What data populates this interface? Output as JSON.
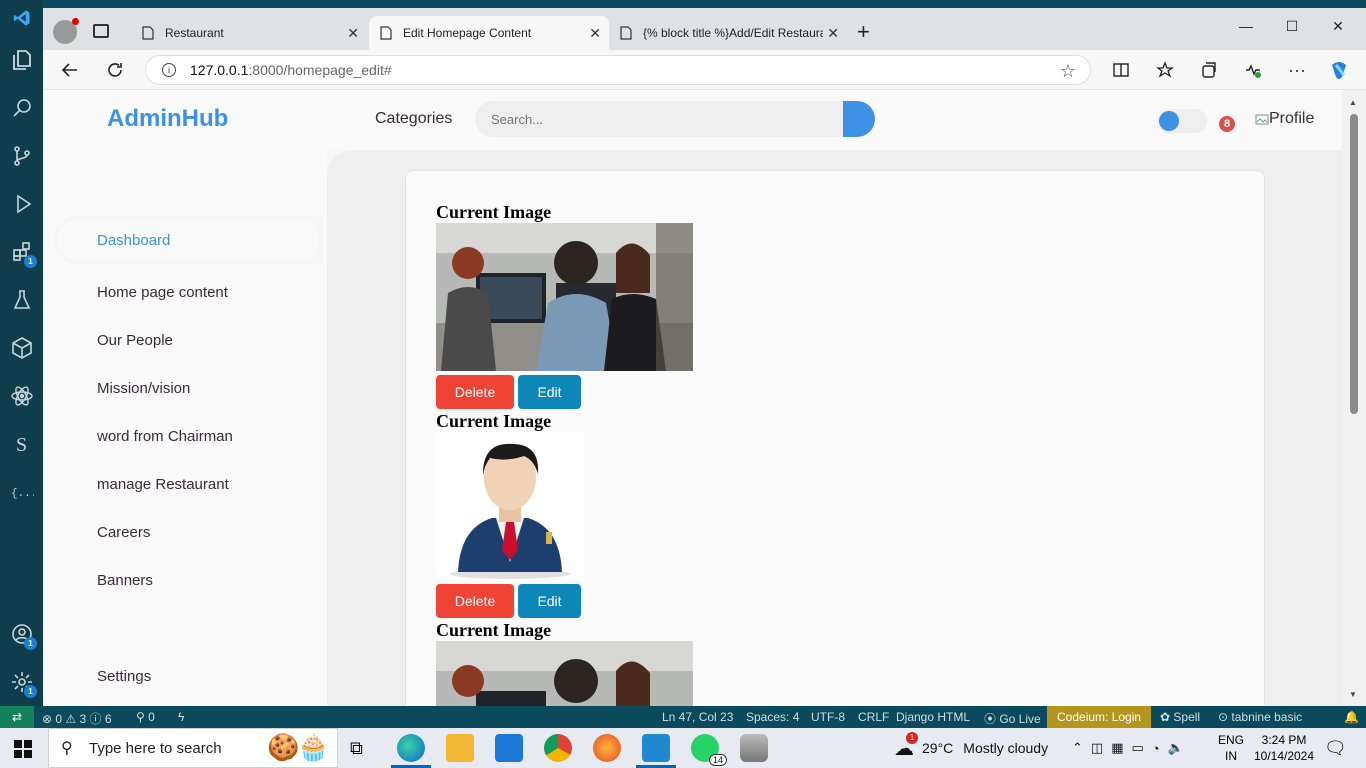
{
  "vscode": {
    "activity_badges": [
      "1",
      "1",
      "1"
    ]
  },
  "browser": {
    "tabs": [
      {
        "label": "Restaurant"
      },
      {
        "label": "Edit Homepage Content"
      },
      {
        "label": "{% block title %}Add/Edit Restaura"
      }
    ],
    "url_host": "127.0.0.1",
    "url_path": ":8000/homepage_edit#"
  },
  "topnav": {
    "brand": "AdminHub",
    "categories": "Categories",
    "search_placeholder": "Search...",
    "notification_count": "8",
    "profile_alt": "Profile"
  },
  "sidebar": {
    "items": [
      {
        "label": "Dashboard"
      },
      {
        "label": "Home page content"
      },
      {
        "label": "Our People"
      },
      {
        "label": "Mission/vision"
      },
      {
        "label": "word from Chairman"
      },
      {
        "label": "manage Restaurant"
      },
      {
        "label": "Careers"
      },
      {
        "label": "Banners"
      }
    ],
    "settings": "Settings"
  },
  "content": {
    "blocks": [
      {
        "title": "Current Image",
        "delete_label": "Delete",
        "edit_label": "Edit"
      },
      {
        "title": "Current Image",
        "delete_label": "Delete",
        "edit_label": "Edit"
      },
      {
        "title": "Current Image"
      }
    ]
  },
  "statusbar": {
    "errors": "0",
    "warnings": "3",
    "info": "6",
    "ports": "0",
    "position": "Ln 47, Col 23",
    "spaces": "Spaces: 4",
    "encoding": "UTF-8",
    "eol": "CRLF",
    "language": "Django HTML",
    "go_live": "Go Live",
    "codeium": "Codeium: Login",
    "spell": "Spell",
    "tabnine": "tabnine basic"
  },
  "taskbar": {
    "search_placeholder": "Type here to search",
    "whatsapp_badge": "14",
    "weather_badge": "1",
    "temperature": "29°C",
    "weather": "Mostly cloudy",
    "lang": "ENG",
    "region": "IN",
    "time": "3:24 PM",
    "date": "10/14/2024"
  },
  "colors": {
    "accent": "#3c91e6",
    "delete": "#ef4335",
    "edit": "#0d87b8",
    "notify": "#db504a"
  }
}
